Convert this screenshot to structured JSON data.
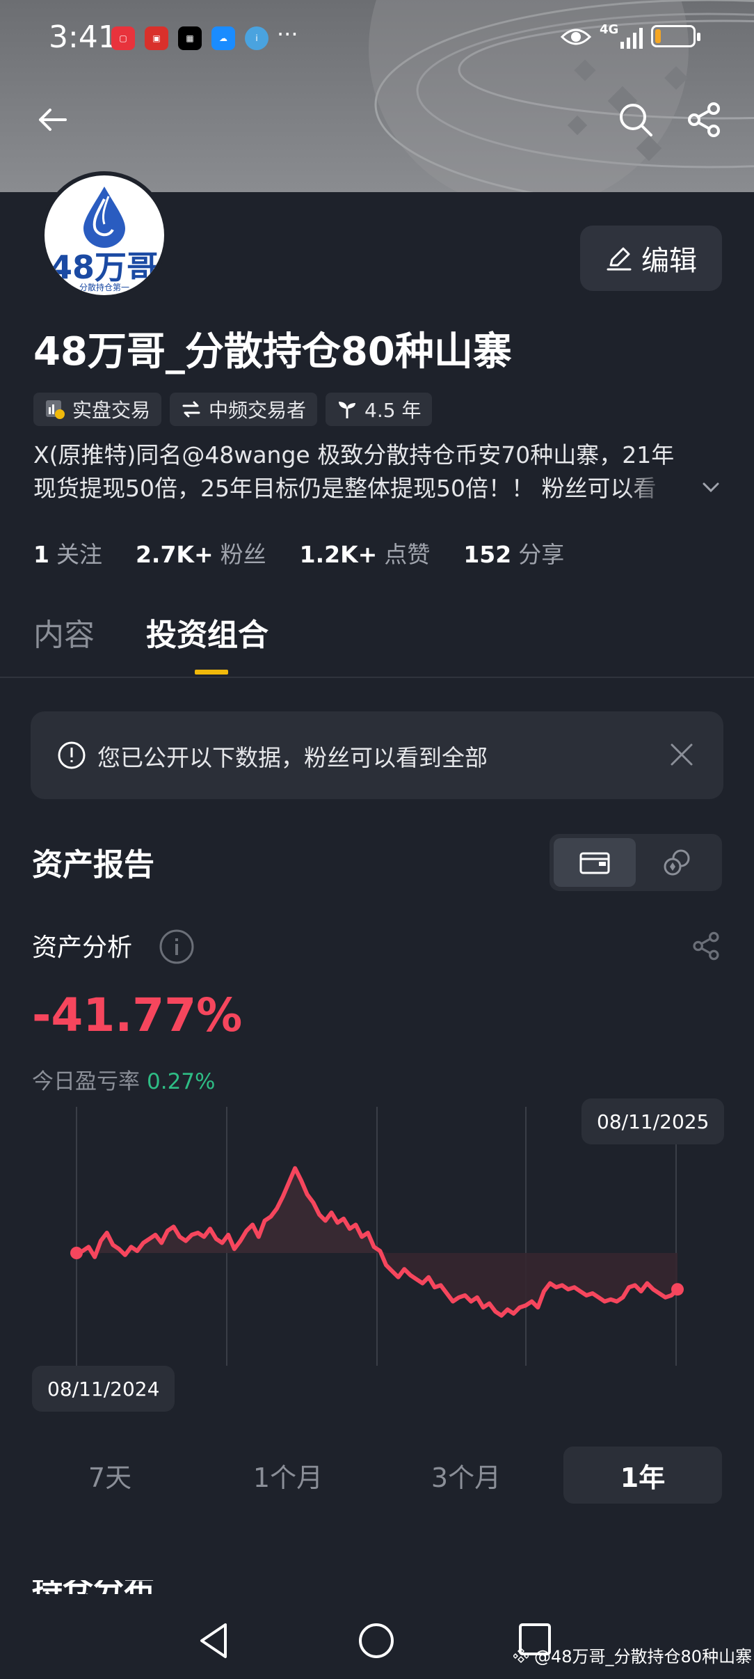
{
  "status_bar": {
    "time": "3:41",
    "app_icons": [
      "huawei-app-icon",
      "bank-app-icon",
      "okx-app-icon",
      "cloud-app-icon",
      "info-app-icon"
    ],
    "more": "···",
    "network": "4G"
  },
  "header": {
    "back": "back-arrow-icon",
    "search": "search-icon",
    "share": "share-icon"
  },
  "profile": {
    "avatar_text": "48万哥",
    "avatar_subtext": "分散持仓第一",
    "edit_label": "编辑",
    "name": "48万哥_分散持仓80种山寨",
    "tags": [
      {
        "icon": "chart-badge-icon",
        "label": "实盘交易"
      },
      {
        "icon": "swap-icon",
        "label": "中频交易者"
      },
      {
        "icon": "sprout-icon",
        "label": "4.5 年"
      }
    ],
    "bio_line1": "X(原推特)同名@48wange 极致分散持仓币安70种山寨，21年",
    "bio_line2": "现货提现50倍，25年目标仍是整体提现50倍！！ 粉丝可以看",
    "stats": [
      {
        "value": "1",
        "label": "关注"
      },
      {
        "value": "2.7K+",
        "label": "粉丝"
      },
      {
        "value": "1.2K+",
        "label": "点赞"
      },
      {
        "value": "152",
        "label": "分享"
      }
    ]
  },
  "tabs": [
    {
      "label": "内容",
      "active": false
    },
    {
      "label": "投资组合",
      "active": true
    }
  ],
  "notice": {
    "text": "您已公开以下数据，粉丝可以看到全部"
  },
  "asset_report": {
    "title": "资产报告",
    "toggle": [
      "wallet-icon",
      "coins-icon"
    ],
    "analysis_label": "资产分析",
    "pnl_percent": "-41.77%",
    "daily_label": "今日盈亏率",
    "daily_value": "0.27%",
    "ranges": [
      {
        "label": "7天",
        "active": false
      },
      {
        "label": "1个月",
        "active": false
      },
      {
        "label": "3个月",
        "active": false
      },
      {
        "label": "1年",
        "active": true
      }
    ]
  },
  "chart_data": {
    "type": "line",
    "title": "",
    "xlabel": "",
    "ylabel": "",
    "start_label": "08/11/2024",
    "end_label": "08/11/2025",
    "baseline": 0.0,
    "color": "#f6465d",
    "values": [
      0.0,
      0.01,
      0.03,
      -0.02,
      0.06,
      0.1,
      0.04,
      0.02,
      -0.01,
      0.03,
      0.01,
      0.05,
      0.07,
      0.09,
      0.05,
      0.11,
      0.13,
      0.08,
      0.06,
      0.09,
      0.1,
      0.08,
      0.12,
      0.07,
      0.05,
      0.09,
      0.02,
      0.06,
      0.11,
      0.14,
      0.08,
      0.16,
      0.18,
      0.22,
      0.28,
      0.35,
      0.42,
      0.36,
      0.29,
      0.25,
      0.19,
      0.16,
      0.2,
      0.15,
      0.17,
      0.12,
      0.14,
      0.08,
      0.1,
      0.03,
      0.01,
      -0.06,
      -0.09,
      -0.12,
      -0.08,
      -0.11,
      -0.13,
      -0.15,
      -0.12,
      -0.17,
      -0.16,
      -0.2,
      -0.24,
      -0.22,
      -0.21,
      -0.24,
      -0.22,
      -0.27,
      -0.25,
      -0.29,
      -0.31,
      -0.28,
      -0.3,
      -0.27,
      -0.26,
      -0.24,
      -0.27,
      -0.19,
      -0.15,
      -0.17,
      -0.16,
      -0.18,
      -0.17,
      -0.19,
      -0.21,
      -0.2,
      -0.22,
      -0.24,
      -0.23,
      -0.24,
      -0.22,
      -0.17,
      -0.16,
      -0.19,
      -0.15,
      -0.18,
      -0.2,
      -0.22,
      -0.21,
      -0.18
    ]
  },
  "nav": {
    "back": "nav-back-icon",
    "home": "nav-home-icon",
    "recent": "nav-recent-icon"
  },
  "watermark": "@48万哥_分散持仓80种山寨",
  "next_section_partial": "持仓分布"
}
